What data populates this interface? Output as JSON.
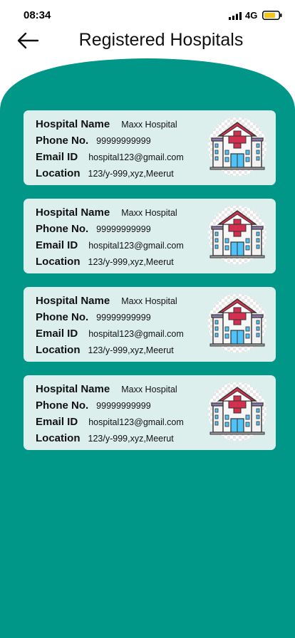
{
  "status_bar": {
    "time": "08:34",
    "network": "4G"
  },
  "header": {
    "title": "Registered Hospitals",
    "back_icon": "arrow-left-icon"
  },
  "colors": {
    "teal": "#009688",
    "card": "#dcefed",
    "battery": "#f5c518"
  },
  "hospitals": [
    {
      "name_label": "Hospital Name",
      "name": "Maxx Hospital",
      "phone_label": "Phone No.",
      "phone": "99999999999",
      "email_label": "Email ID",
      "email": "hospital123@gmail.com",
      "location_label": "Location",
      "location": "123/y-999,xyz,Meerut",
      "icon": "hospital-building-icon"
    },
    {
      "name_label": "Hospital Name",
      "name": "Maxx Hospital",
      "phone_label": "Phone No.",
      "phone": "99999999999",
      "email_label": "Email ID",
      "email": "hospital123@gmail.com",
      "location_label": "Location",
      "location": "123/y-999,xyz,Meerut",
      "icon": "hospital-building-icon"
    },
    {
      "name_label": "Hospital Name",
      "name": "Maxx Hospital",
      "phone_label": "Phone No.",
      "phone": "99999999999",
      "email_label": "Email ID",
      "email": "hospital123@gmail.com",
      "location_label": "Location",
      "location": "123/y-999,xyz,Meerut",
      "icon": "hospital-building-icon"
    },
    {
      "name_label": "Hospital Name",
      "name": "Maxx Hospital",
      "phone_label": "Phone No.",
      "phone": "99999999999",
      "email_label": "Email ID",
      "email": "hospital123@gmail.com",
      "location_label": "Location",
      "location": "123/y-999,xyz,Meerut",
      "icon": "hospital-building-icon"
    }
  ]
}
